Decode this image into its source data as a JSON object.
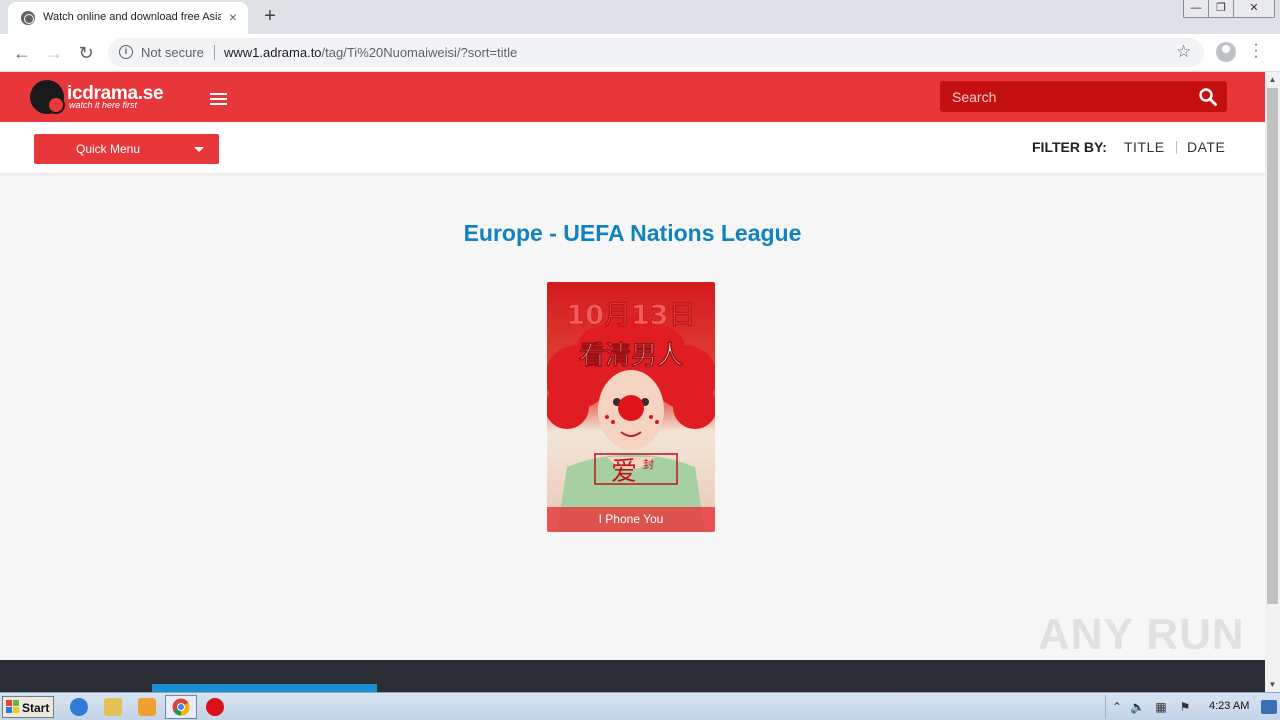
{
  "browser": {
    "tab_title": "Watch online and download free Asian drama",
    "tab_close": "×",
    "new_tab": "+",
    "security_label": "Not secure",
    "url_host": "www1.adrama.to",
    "url_path": "/tag/Ti%20Nuomaiweisi/?sort=title",
    "window_minimize": "—",
    "window_restore": "❐",
    "window_close": "✕"
  },
  "site": {
    "logo_text": "icdrama.se",
    "logo_tagline": "watch it here first",
    "search_placeholder": "Search",
    "quick_menu_label": "Quick Menu",
    "filter": {
      "label": "FILTER BY:",
      "options": [
        "TITLE",
        "DATE"
      ]
    },
    "page_heading": "Europe - UEFA Nations League",
    "items": [
      {
        "caption": "I Phone You",
        "poster_text_1": "10月13日",
        "poster_text_2": "看清男人"
      }
    ],
    "accent_color": "#e8373a",
    "heading_color": "#1282bf"
  },
  "watermark": "ANY RUN",
  "taskbar": {
    "start_label": "Start",
    "clock": "4:23 AM"
  }
}
